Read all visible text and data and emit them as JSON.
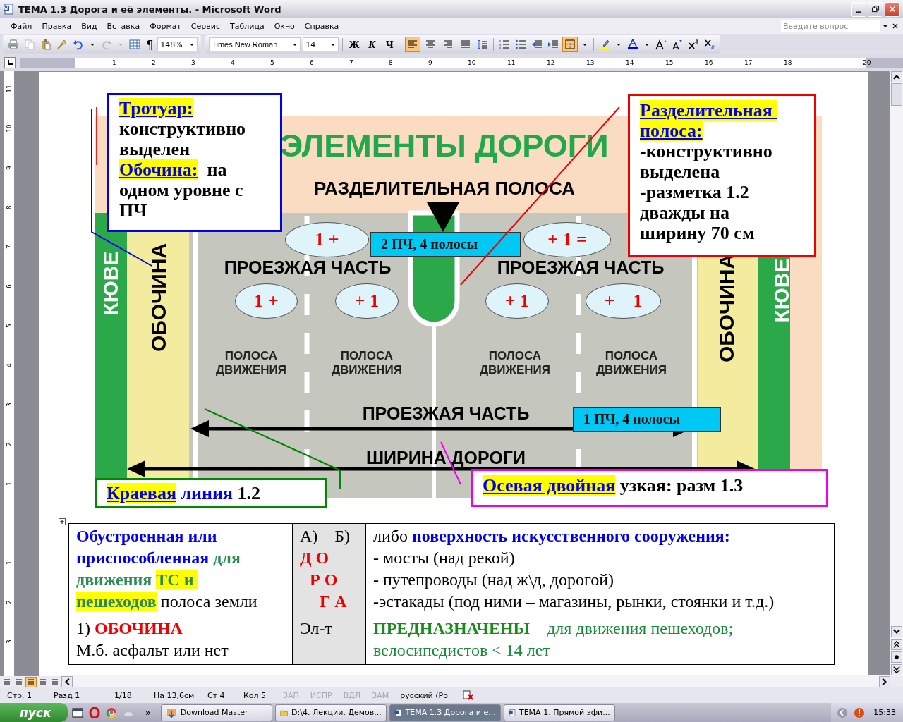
{
  "window": {
    "title": "ТЕМА 1.3 Дорога и её элементы. - Microsoft Word"
  },
  "menu": [
    "Файл",
    "Правка",
    "Вид",
    "Вставка",
    "Формат",
    "Сервис",
    "Таблица",
    "Окно",
    "Справка"
  ],
  "help_box": {
    "placeholder": "Введите вопрос"
  },
  "toolbar": {
    "pilcrow": "¶",
    "zoom": "148%",
    "font": "Times New Roman",
    "size": "14",
    "format_buttons": [
      "Ж",
      "К",
      "Ч"
    ],
    "align_buttons": [
      {
        "selected": true
      },
      {
        "selected": false
      },
      {
        "selected": false
      },
      {
        "selected": false
      }
    ],
    "border_button": {
      "selected": true
    }
  },
  "ruler": {
    "labels": [
      "1",
      "2",
      "3",
      "4",
      "5",
      "6",
      "7",
      "8",
      "9",
      "10",
      "11",
      "12",
      "13",
      "14",
      "15",
      "16",
      "17",
      "18",
      "20"
    ]
  },
  "vertical_ruler": {
    "labels": [
      "11",
      "10",
      "9",
      "8",
      "7",
      "6",
      "5",
      "4",
      "3",
      "2",
      "1",
      "1",
      "2",
      "3"
    ]
  },
  "diagram": {
    "title": "ЭЛЕМЕНТЫ ДОРОГИ",
    "subtitle": "РАЗДЕЛИТЕЛЬНАЯ ПОЛОСА",
    "side_labels": [
      {
        "text": "КЮВЕ",
        "kind": "ditch"
      },
      {
        "text": "ОБОЧИНА",
        "kind": "shoulder"
      },
      {
        "text": "ОБОЧИНА",
        "kind": "shoulder"
      },
      {
        "text": "КЮВЕ",
        "kind": "ditch"
      }
    ],
    "roadway_labels": [
      "ПРОЕЗЖАЯ ЧАСТЬ",
      "ПРОЕЗЖАЯ ЧАСТЬ",
      "ПРОЕЗЖАЯ ЧАСТЬ",
      "ШИРИНА ДОРОГИ"
    ],
    "lane_labels": [
      "ПОЛОСА ДВИЖЕНИЯ",
      "ПОЛОСА ДВИЖЕНИЯ",
      "ПОЛОСА ДВИЖЕНИЯ",
      "ПОЛОСА ДВИЖЕНИЯ"
    ],
    "ovals": [
      "1 +",
      "+ 1 =",
      "1 +",
      "+ 1",
      "+ 1",
      "+    1"
    ],
    "info_tags": [
      "2 ПЧ, 4 полосы",
      "1 ПЧ, 4 полосы"
    ]
  },
  "callouts": [
    {
      "paragraphs": [
        [
          {
            "t": "Тротуар:",
            "kind": "hl"
          }
        ],
        [
          {
            "t": "конструктивно выделен",
            "kind": "black"
          }
        ],
        [
          {
            "t": "Обочина:",
            "kind": "hl"
          },
          {
            "t": "  на одном уровне с ПЧ",
            "kind": "black"
          }
        ]
      ]
    },
    {
      "paragraphs": [
        [
          {
            "t": "Разделительная полоса:",
            "kind": "hl"
          }
        ],
        [
          {
            "t": "-конструктивно выделена",
            "kind": "black"
          }
        ],
        [
          {
            "t": "-разметка 1.2 дважды на ширину 70 см",
            "kind": "black"
          }
        ]
      ]
    },
    {
      "paragraphs": [
        [
          {
            "t": "Краевая",
            "kind": "hl"
          },
          {
            "t": " линия",
            "kind": "blue"
          },
          {
            "t": " 1.2",
            "kind": "black"
          }
        ]
      ]
    },
    {
      "paragraphs": [
        [
          {
            "t": "Осевая двойная",
            "kind": "hl"
          },
          {
            "t": " узкая: разм 1.3",
            "kind": "black"
          }
        ]
      ]
    }
  ],
  "table": {
    "rows": [
      {
        "cells": [
          {
            "paragraphs": [
              [
                {
                  "t": "Обустроенная или приспособленная",
                  "kind": "blue"
                },
                {
                  "t": " для движения ",
                  "kind": "green"
                },
                {
                  "t": "ТС и пешеходов",
                  "kind": "greenhl"
                },
                {
                  "t": " полоса земли",
                  "kind": "plain"
                }
              ]
            ]
          },
          {
            "paragraphs": [
              [
                {
                  "t": "А)    Б)",
                  "kind": "plain"
                }
              ],
              [
                {
                  "t": "Д О",
                  "kind": "red"
                }
              ],
              [
                {
                  "t": "Р О",
                  "kind": "red"
                }
              ],
              [
                {
                  "t": "Г А",
                  "kind": "red"
                }
              ]
            ]
          },
          {
            "paragraphs": [
              [
                {
                  "t": "либо ",
                  "kind": "plain"
                },
                {
                  "t": "поверхность искусственного сооружения:",
                  "kind": "blue"
                }
              ],
              [
                {
                  "t": "- мосты (над рекой)",
                  "kind": "plain"
                }
              ],
              [
                {
                  "t": "- путепроводы (над ж\\д, дорогой)",
                  "kind": "plain"
                }
              ],
              [
                {
                  "t": "-эстакады (под ними – магазины, рынки, стоянки и т.д.)",
                  "kind": "plain"
                }
              ]
            ]
          }
        ]
      },
      {
        "cells": [
          {
            "paragraphs": [
              [
                {
                  "t": "1) ",
                  "kind": "plain"
                },
                {
                  "t": "ОБОЧИНА",
                  "kind": "red"
                }
              ],
              [
                {
                  "t": "М.б. асфальт или нет",
                  "kind": "plain"
                }
              ]
            ]
          },
          {
            "paragraphs": [
              [
                {
                  "t": "Эл-т",
                  "kind": "plain"
                }
              ]
            ]
          },
          {
            "paragraphs": [
              [
                {
                  "t": "ПРЕДНАЗНАЧЕНЫ",
                  "kind": "greenbold"
                },
                {
                  "t": "    для движения пешеходов;",
                  "kind": "green"
                }
              ],
              [
                {
                  "t": "велосипедистов < 14 лет",
                  "kind": "green"
                }
              ]
            ]
          }
        ]
      }
    ]
  },
  "status_bar": [
    {
      "text": "Стр. 1",
      "disabled": false
    },
    {
      "text": "Разд 1",
      "disabled": false
    },
    {
      "text": "1/18",
      "disabled": false
    },
    {
      "text": "На 13,6см",
      "disabled": false
    },
    {
      "text": "Ст 4",
      "disabled": false
    },
    {
      "text": "Кол 5",
      "disabled": false
    },
    {
      "text": "ЗАП",
      "disabled": true
    },
    {
      "text": "ИСПР",
      "disabled": true
    },
    {
      "text": "ВДЛ",
      "disabled": true
    },
    {
      "text": "ЗАМ",
      "disabled": true
    },
    {
      "text": "русский (Ро",
      "disabled": false
    }
  ],
  "view_buttons": [
    {
      "selected": false
    },
    {
      "selected": false
    },
    {
      "selected": true
    },
    {
      "selected": false
    },
    {
      "selected": false
    }
  ],
  "taskbar": {
    "start": "пуск",
    "more": "»",
    "tasks": [
      {
        "label": "Download Master",
        "selected": false
      },
      {
        "label": "D:\\4. Лекции. Демов...",
        "selected": false
      },
      {
        "label": "ТЕМА 1.3 Дорога и е...",
        "selected": true
      },
      {
        "label": "ТЕМА 1. Прямой эфи...",
        "selected": false
      }
    ],
    "clock": "15:33"
  }
}
